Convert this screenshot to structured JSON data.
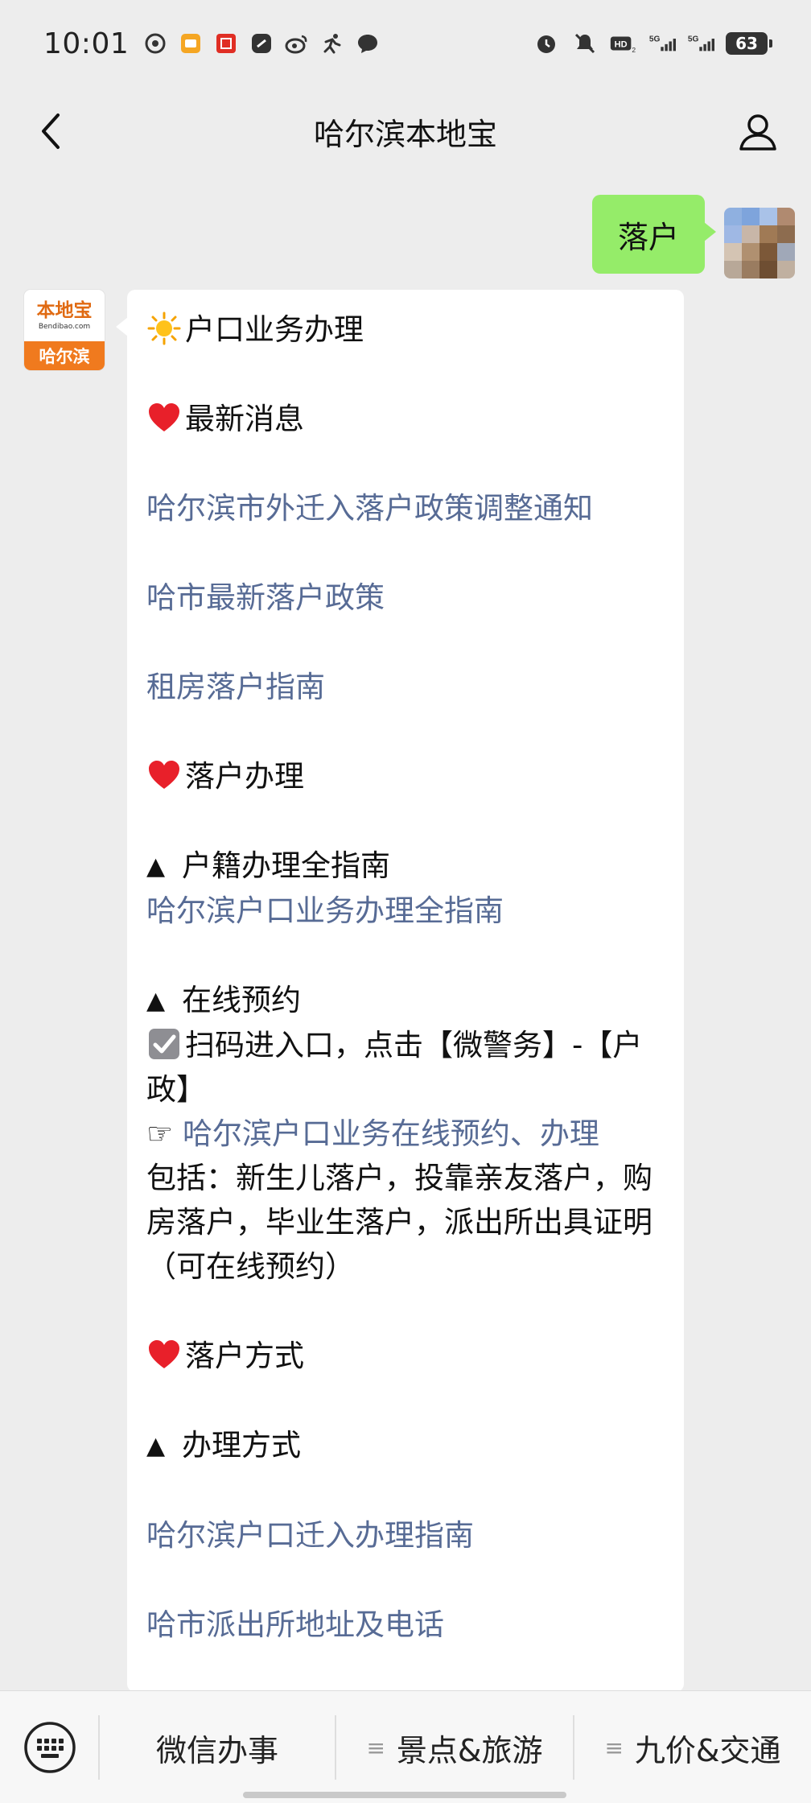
{
  "status_bar": {
    "time": "10:01",
    "battery": "63",
    "left_icons": [
      "netease-icon",
      "shopping-app-icon",
      "store-app-icon",
      "link-app-icon",
      "weibo-icon",
      "fitness-icon",
      "chat-icon"
    ],
    "right_icons": [
      "alarm-icon",
      "mute-icon",
      "hd-icon",
      "signal-5g-icon",
      "signal-5g-icon"
    ],
    "hd_label": "HD",
    "net_label": "5G"
  },
  "header": {
    "title": "哈尔滨本地宝"
  },
  "chat": {
    "user_message": "落户",
    "bot_avatar": {
      "brand": "本地宝",
      "url": "Bendibao.com",
      "city": "哈尔滨"
    },
    "reply": {
      "section1_title": "户口业务办理",
      "news_heading": "最新消息",
      "link1": "哈尔滨市外迁入落户政策调整通知",
      "link2": "哈市最新落户政策",
      "link3": "租房落户指南",
      "process_heading": "落户办理",
      "guide_label": "户籍办理全指南",
      "link4": "哈尔滨户口业务办理全指南",
      "online_label": "在线预约",
      "scan_text": "扫码进入口，点击【微警务】-【户政】",
      "pointer": "☞",
      "link5": "哈尔滨户口业务在线预约、办理",
      "includes_text": "包括：新生儿落户，投靠亲友落户，购房落户，毕业生落户，派出所出具证明（可在线预约）",
      "method_heading": "落户方式",
      "handle_label": "办理方式",
      "link6": "哈尔滨户口迁入办理指南",
      "link7": "哈市派出所地址及电话"
    }
  },
  "bottom_menu": {
    "item1": "微信办事",
    "item2": "景点&旅游",
    "item3": "九价&交通"
  },
  "colors": {
    "background": "#ededed",
    "user_bubble": "#95ec69",
    "link": "#576b95",
    "brand_orange": "#f07a1e"
  }
}
